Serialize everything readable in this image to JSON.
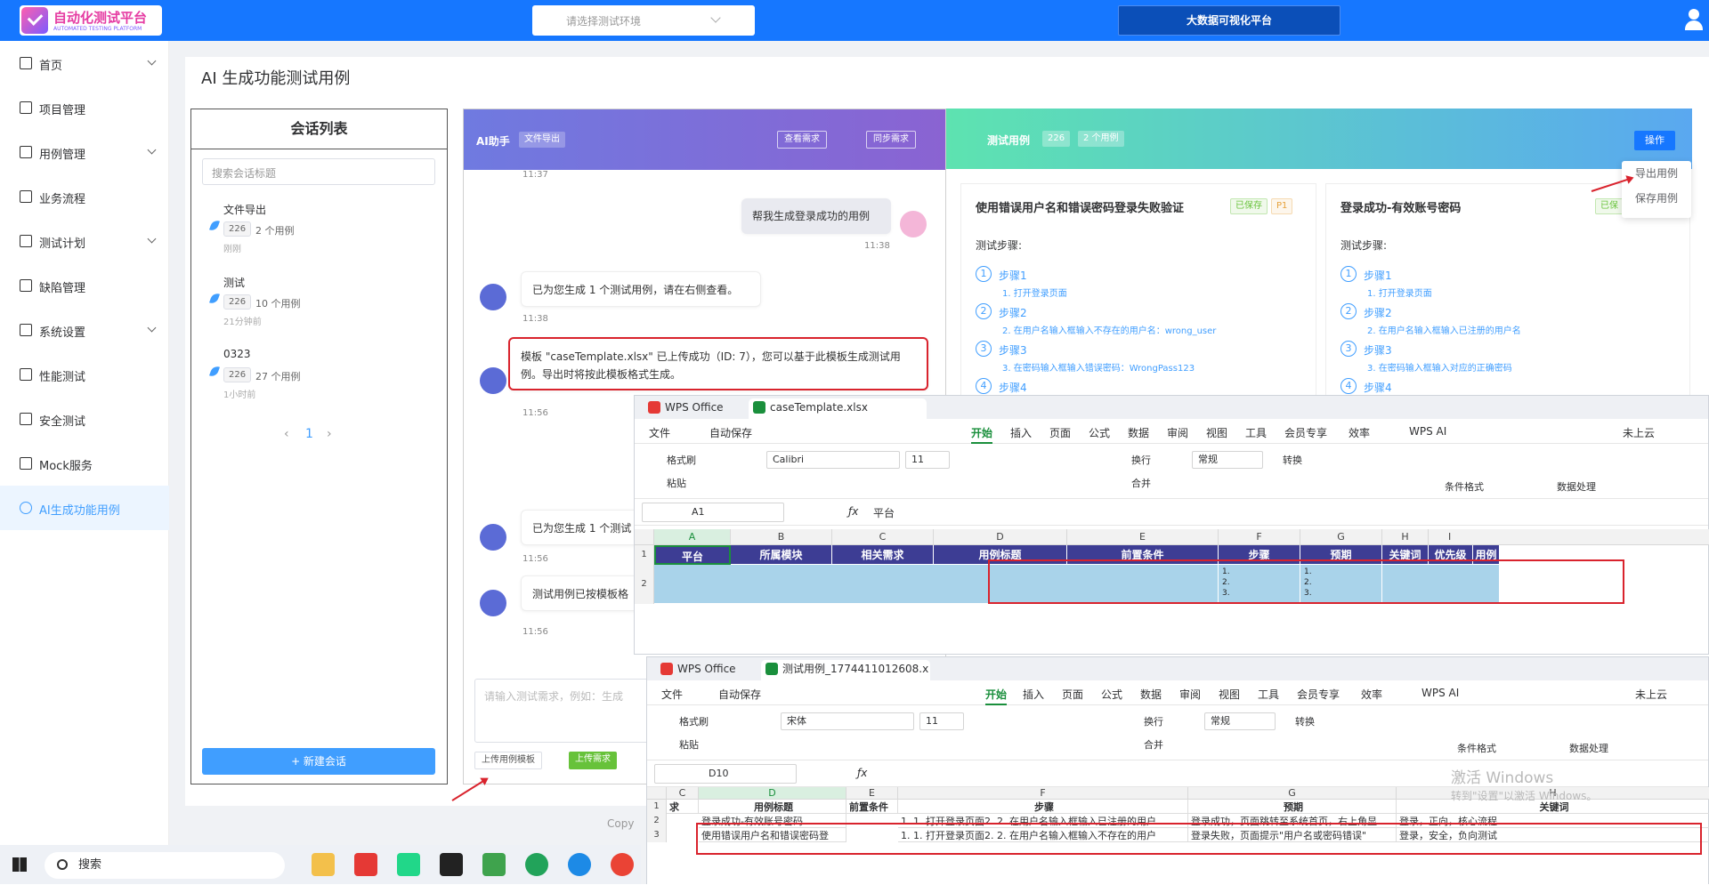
{
  "header": {
    "logo_title": "自动化测试平台",
    "logo_subtitle": "AUTOMATED TESTING PLATFORM",
    "env_placeholder": "请选择测试环境",
    "bigdata_button": "大数据可视化平台"
  },
  "sidebar": {
    "items": [
      {
        "label": "首页"
      },
      {
        "label": "项目管理"
      },
      {
        "label": "用例管理"
      },
      {
        "label": "业务流程"
      },
      {
        "label": "测试计划"
      },
      {
        "label": "缺陷管理"
      },
      {
        "label": "系统设置"
      },
      {
        "label": "性能测试"
      },
      {
        "label": "安全测试"
      },
      {
        "label": "Mock服务"
      },
      {
        "label": "AI生成功能用例"
      }
    ]
  },
  "page": {
    "title": "AI 生成功能测试用例",
    "footer": "Copy"
  },
  "sessions": {
    "title": "会话列表",
    "search_placeholder": "搜索会话标题",
    "items": [
      {
        "name": "文件导出",
        "badge": "226",
        "count": "2 个用例",
        "time": "刚刚"
      },
      {
        "name": "测试",
        "badge": "226",
        "count": "10 个用例",
        "time": "21分钟前"
      },
      {
        "name": "0323",
        "badge": "226",
        "count": "27 个用例",
        "time": "1小时前"
      }
    ],
    "page_current": "1",
    "new_button": "+ 新建会话"
  },
  "chat": {
    "title": "AI助手",
    "tag": "文件导出",
    "btn_view": "查看需求",
    "btn_sync": "同步需求",
    "t0": "11:37",
    "user_msg": "帮我生成登录成功的用例",
    "t1": "11:38",
    "ai_msg1": "已为您生成 1 个测试用例，请在右侧查看。",
    "t2": "11:38",
    "ai_msg2": "模板 \"caseTemplate.xlsx\" 已上传成功（ID: 7），您可以基于此模板生成测试用例。导出时将按此模板格式生成。",
    "t3": "11:56",
    "ai_msg3": "已为您生成 1 个测试",
    "t4": "11:56",
    "ai_msg4": "测试用例已按模板格",
    "t5": "11:56",
    "input_placeholder": "请输入测试需求，例如：生成",
    "upload_tpl": "上传用例模板",
    "upload_req": "上传需求"
  },
  "cases": {
    "title": "测试用例",
    "badge1": "226",
    "badge2": "2 个用例",
    "op_button": "操作",
    "dropdown": [
      "导出用例",
      "保存用例"
    ],
    "card1": {
      "title": "使用错误用户名和错误密码登录失败验证",
      "tag1": "已保存",
      "tag2": "P1",
      "steps_label": "测试步骤:",
      "steps": [
        {
          "n": "1",
          "t": "步骤1",
          "d": "1. 打开登录页面"
        },
        {
          "n": "2",
          "t": "步骤2",
          "d": "2. 在用户名输入框输入不存在的用户名：wrong_user"
        },
        {
          "n": "3",
          "t": "步骤3",
          "d": "3. 在密码输入框输入错误密码：WrongPass123"
        },
        {
          "n": "4",
          "t": "步骤4",
          "d": ""
        }
      ]
    },
    "card2": {
      "title": "登录成功-有效账号密码",
      "tag1": "已保",
      "steps_label": "测试步骤:",
      "steps": [
        {
          "n": "1",
          "t": "步骤1",
          "d": "1. 打开登录页面"
        },
        {
          "n": "2",
          "t": "步骤2",
          "d": "2. 在用户名输入框输入已注册的用户名"
        },
        {
          "n": "3",
          "t": "步骤3",
          "d": "3. 在密码输入框输入对应的正确密码"
        },
        {
          "n": "4",
          "t": "步骤4",
          "d": ""
        }
      ]
    }
  },
  "wps1": {
    "app": "WPS Office",
    "file": "caseTemplate.xlsx",
    "menu": [
      "文件",
      "自动保存",
      "开始",
      "插入",
      "页面",
      "公式",
      "数据",
      "审阅",
      "视图",
      "工具",
      "会员专享",
      "效率",
      "WPS AI",
      "未上云"
    ],
    "font": "Calibri",
    "size": "11",
    "format": "常规",
    "ribbon": [
      "格式刷",
      "粘贴",
      "换行",
      "转换",
      "合并",
      "条件格式",
      "数据处理"
    ],
    "cellref": "A1",
    "formula": "平台",
    "cols": [
      "A",
      "B",
      "C",
      "D",
      "E",
      "F",
      "G",
      "H",
      "I"
    ],
    "headers": [
      "平台",
      "所属模块",
      "相关需求",
      "用例标题",
      "前置条件",
      "步骤",
      "预期",
      "关键词",
      "优先级",
      "用例"
    ],
    "rows": [
      "1",
      "2"
    ],
    "list_marks": [
      "1.",
      "2.",
      "3."
    ]
  },
  "wps2": {
    "app": "WPS Office",
    "file": "测试用例_17744110126​08.x",
    "menu": [
      "文件",
      "自动保存",
      "开始",
      "插入",
      "页面",
      "公式",
      "数据",
      "审阅",
      "视图",
      "工具",
      "会员专享",
      "效率",
      "WPS AI",
      "未上云"
    ],
    "font": "宋体",
    "size": "11",
    "format": "常规",
    "ribbon": [
      "格式刷",
      "粘贴",
      "换行",
      "转换",
      "合并",
      "条件格式",
      "数据处理"
    ],
    "cellref": "D10",
    "cols": [
      "C",
      "D",
      "E",
      "F",
      "G",
      "H"
    ],
    "headers": [
      "求",
      "用例标题",
      "前置条件",
      "步骤",
      "预期",
      "关键词"
    ],
    "rows": [
      {
        "n": "1"
      },
      {
        "n": "2",
        "d": "登录成功-有效账号密码",
        "f": "1. 1. 打开登录页面2. 2. 在用户名输入框输入已注册的用户",
        "g": "登录成功，页面跳转至系统首页，右上角显",
        "h": "登录，正向，核心流程"
      },
      {
        "n": "3",
        "d": "使用错误用户名和错误密码登",
        "f": "1. 1. 打开登录页面2. 2. 在用户名输入框输入不存在的用户",
        "g": "登录失败，页面提示\"用户名或密码错误\"",
        "h": "登录，安全，负向测试"
      }
    ]
  },
  "taskbar": {
    "search": "搜索"
  },
  "watermark": {
    "line1": "激活 Windows",
    "line2": "转到\"设置\"以激活 Windows。"
  }
}
